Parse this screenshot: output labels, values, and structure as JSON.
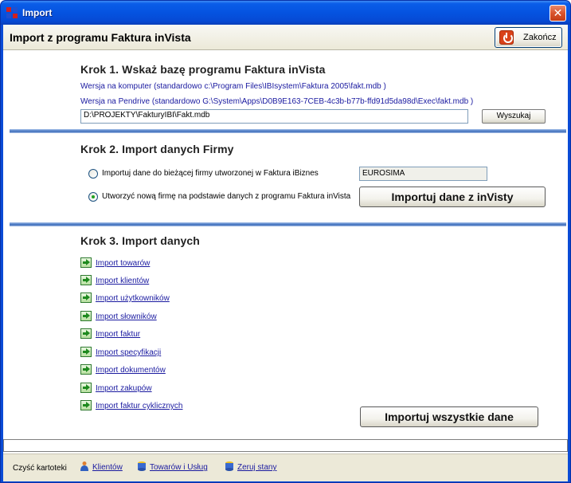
{
  "window": {
    "title": "Import",
    "close_glyph": "✕"
  },
  "header": {
    "heading": "Import z programu Faktura inVista",
    "close_button": "Zakończ"
  },
  "step1": {
    "title": "Krok 1.  Wskaż bazę programu Faktura inVista",
    "hint_computer": "Wersja na komputer  (standardowo  c:\\Program Files\\IBIsystem\\Faktura 2005\\fakt.mdb )",
    "hint_pendrive": "Wersja na Pendrive  (standardowo  G:\\System\\Apps\\D0B9E163-7CEB-4c3b-b77b-ffd91d5da98d\\Exec\\fakt.mdb )",
    "path_value": "D:\\PROJEKTY\\FakturyIBI\\Fakt.mdb",
    "search_button": "Wyszukaj"
  },
  "step2": {
    "title": "Krok 2.  Import danych Firmy",
    "option_existing": "Importuj dane do bieżącej firmy utworzonej w Faktura iBiznes",
    "option_new": "Utworzyć nową firmę na podstawie danych z programu Faktura inVista",
    "selected": "option_new",
    "firm_value": "EUROSIMA",
    "import_button": "Importuj dane z inVisty"
  },
  "step3": {
    "title": "Krok 3.  Import danych",
    "items": [
      {
        "label": "Import towarów"
      },
      {
        "label": "Import klientów"
      },
      {
        "label": "Import użytkowników"
      },
      {
        "label": "Import słowników"
      },
      {
        "label": "Import faktur"
      },
      {
        "label": "Import specyfikacji"
      },
      {
        "label": "Import dokumentów"
      },
      {
        "label": "Import zakupów"
      },
      {
        "label": "Import faktur cyklicznych"
      }
    ],
    "import_all_button": "Importuj wszystkie dane"
  },
  "footer": {
    "caption": "Czyść kartoteki",
    "link_clients": "Klientów",
    "link_goods": "Towarów i Usług",
    "link_reset": "Zeruj stany"
  },
  "colors": {
    "title_bar": "#0553e0",
    "link": "#1a1aa0",
    "divider": "#4f7fc8",
    "face": "#ece9d8"
  }
}
